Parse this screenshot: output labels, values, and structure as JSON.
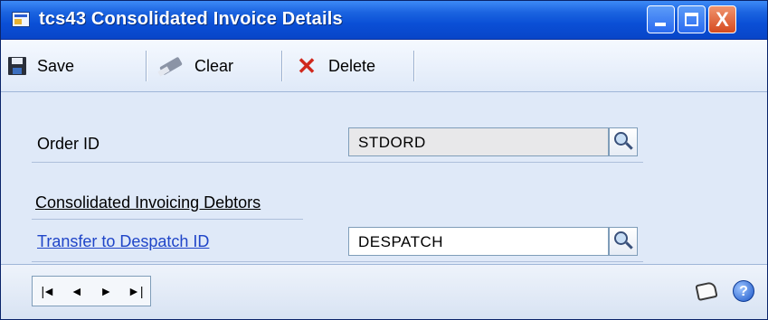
{
  "window": {
    "title": "tcs43 Consolidated Invoice Details",
    "controls": {
      "minimize": "",
      "maximize": "",
      "close": "X"
    }
  },
  "toolbar": {
    "save_label": "Save",
    "clear_label": "Clear",
    "delete_label": "Delete"
  },
  "form": {
    "order_id_label": "Order ID",
    "order_id_value": "STDORD",
    "section_heading": "Consolidated Invoicing Debtors",
    "transfer_label": "Transfer to Despatch ID",
    "despatch_value": "DESPATCH"
  },
  "navigation": {
    "first": "|◄",
    "previous": "◄",
    "next": "►",
    "last": "►|"
  },
  "help": {
    "glyph": "?"
  },
  "colors": {
    "titlebar": "#0a4fd6",
    "link": "#1f45c8",
    "close_button": "#d54a1f",
    "form_background": "#dfe9f8"
  },
  "icons": [
    "app-icon",
    "save-icon",
    "clear-eraser-icon",
    "delete-x-icon",
    "lookup-icon",
    "note-icon",
    "help-icon"
  ]
}
